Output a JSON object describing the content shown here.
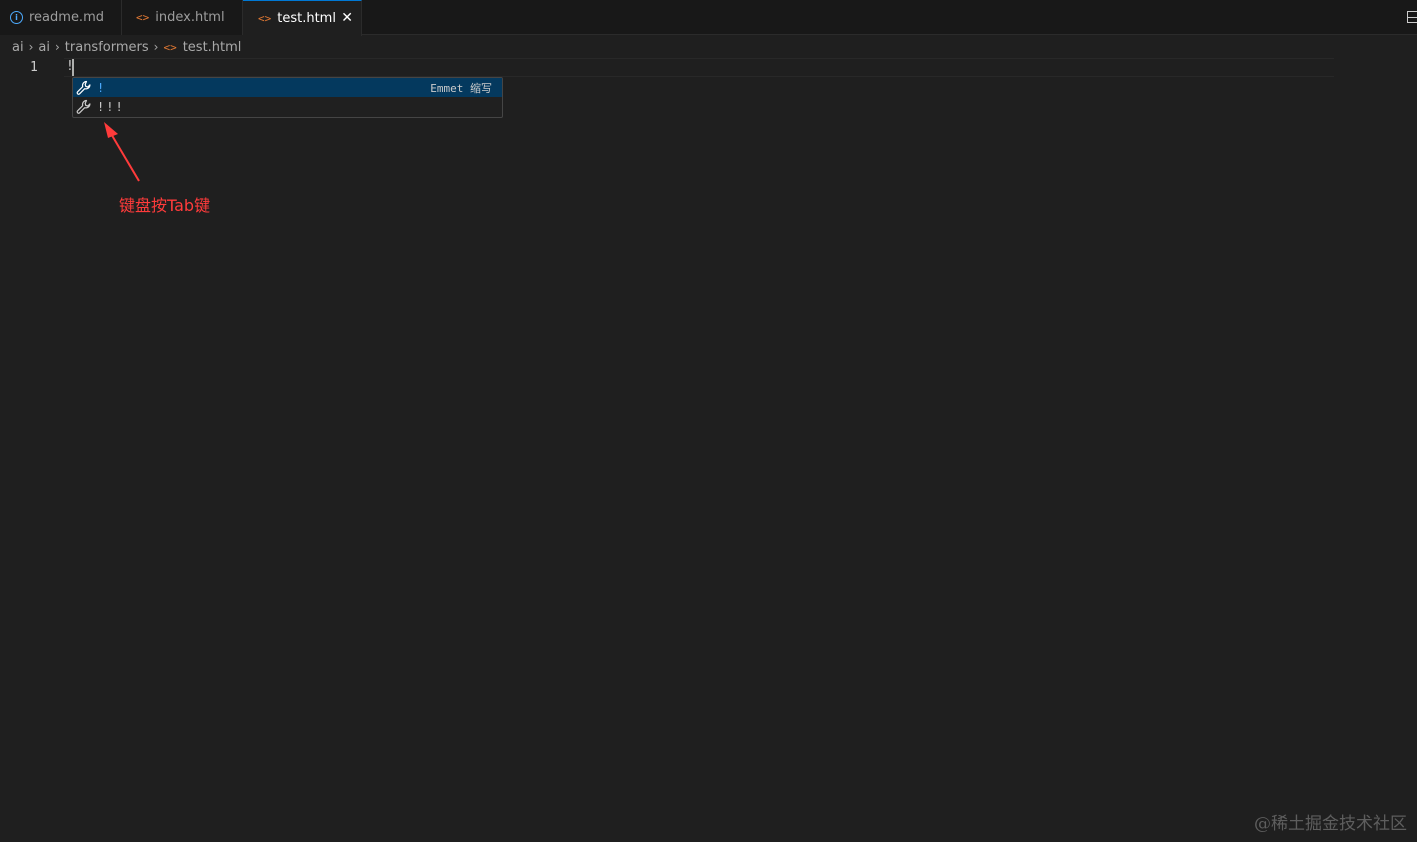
{
  "tabs": [
    {
      "label": "readme.md",
      "icon": "info-icon",
      "active": false
    },
    {
      "label": "index.html",
      "icon": "html-icon",
      "active": false
    },
    {
      "label": "test.html",
      "icon": "html-icon",
      "active": true
    }
  ],
  "html_glyph": "<>",
  "close_glyph": "✕",
  "breadcrumb": {
    "items": [
      "ai",
      "ai",
      "transformers",
      "test.html"
    ],
    "separator": "›"
  },
  "editor": {
    "line_number": "1",
    "code": "!"
  },
  "suggestions": [
    {
      "label": "!",
      "detail": "Emmet 缩写",
      "icon": "wrench-icon",
      "selected": true
    },
    {
      "label": "!!!",
      "detail": "",
      "icon": "wrench-icon",
      "selected": false
    }
  ],
  "annotation": "键盘按Tab键",
  "annotation_color": "#ff3b3b",
  "watermark": "@稀土掘金技术社区",
  "colors": {
    "accent": "#0078d4",
    "html_icon": "#e37933",
    "selection": "#04395e"
  }
}
